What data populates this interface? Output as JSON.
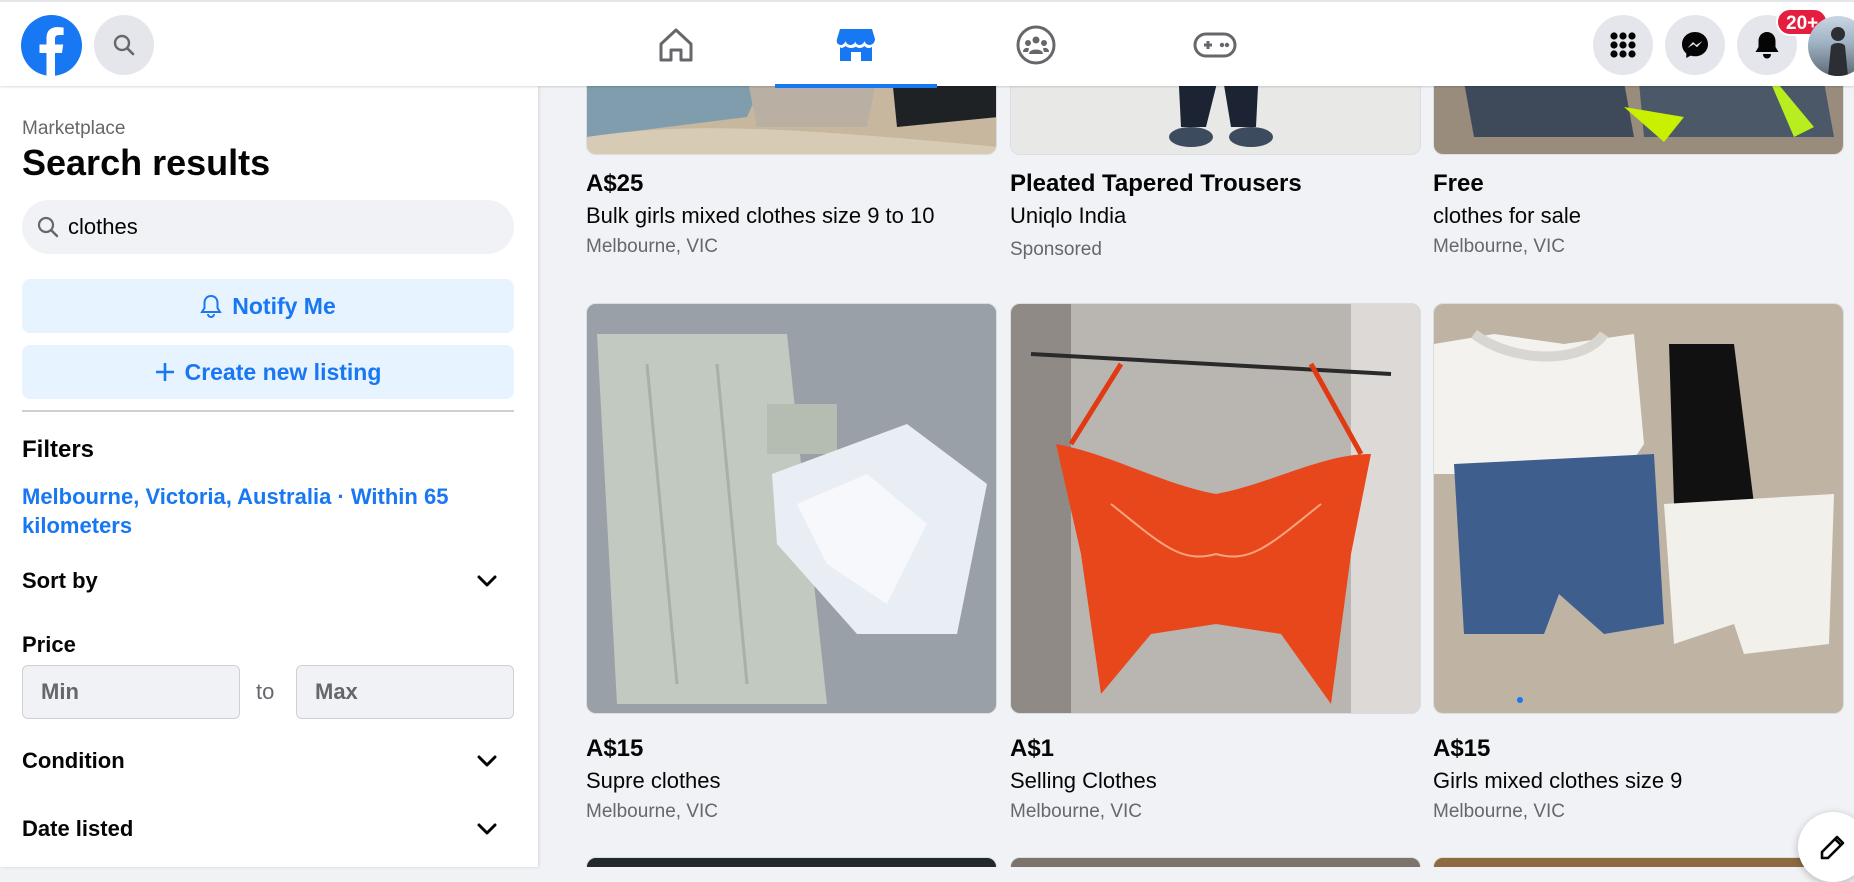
{
  "nav": {
    "search_icon": "search-icon",
    "tabs": [
      {
        "name": "home",
        "icon": "home-icon"
      },
      {
        "name": "marketplace",
        "icon": "marketplace-store-icon",
        "active": true
      },
      {
        "name": "groups",
        "icon": "groups-icon"
      },
      {
        "name": "gaming",
        "icon": "gamepad-icon"
      }
    ],
    "notification_badge": "20+",
    "accent": "#1877f2",
    "badge_color": "#e41e3f"
  },
  "sidebar": {
    "breadcrumb": "Marketplace",
    "title": "Search results",
    "search_value": "clothes",
    "notify_label": "Notify Me",
    "create_label": "Create new listing",
    "filters_title": "Filters",
    "location": "Melbourne, Victoria, Australia · Within 65 kilometers",
    "sort_label": "Sort by",
    "price_label": "Price",
    "price_min_placeholder": "Min",
    "price_max_placeholder": "Max",
    "price_to": "to",
    "condition_label": "Condition",
    "date_label": "Date listed"
  },
  "listings": [
    {
      "price": "A$25",
      "title": "Bulk girls mixed clothes size 9 to 10",
      "location": "Melbourne, VIC"
    },
    {
      "price": "Pleated Tapered Trousers",
      "title": "Uniqlo India",
      "location": "Sponsored"
    },
    {
      "price": "Free",
      "title": "clothes for sale",
      "location": "Melbourne, VIC"
    },
    {
      "price": "A$15",
      "title": "Supre clothes",
      "location": "Melbourne, VIC"
    },
    {
      "price": "A$1",
      "title": "Selling Clothes",
      "location": "Melbourne, VIC"
    },
    {
      "price": "A$15",
      "title": "Girls mixed clothes size 9",
      "location": "Melbourne, VIC"
    }
  ]
}
